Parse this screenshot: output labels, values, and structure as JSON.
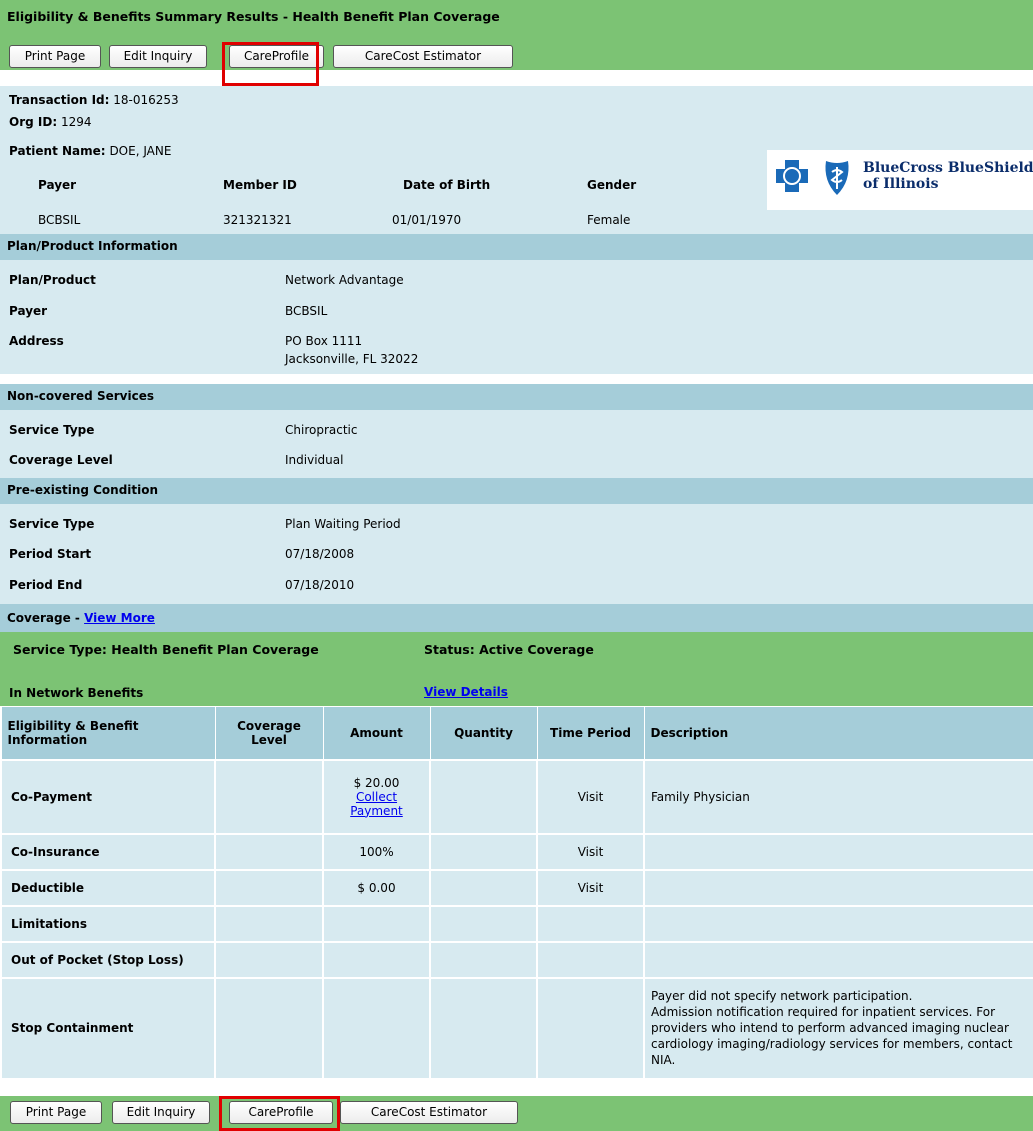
{
  "title": "Eligibility & Benefits Summary Results - Health Benefit Plan Coverage",
  "toolbar": {
    "print": "Print Page",
    "edit": "Edit Inquiry",
    "careprofile": "CareProfile",
    "carecost": "CareCost Estimator"
  },
  "transaction": {
    "txn_label": "Transaction Id:",
    "txn_value": "18-016253",
    "org_label": "Org ID:",
    "org_value": "1294",
    "patient_label": "Patient Name:",
    "patient_value": "DOE, JANE",
    "headers": [
      "Payer",
      "Member ID",
      "Date of Birth",
      "Gender"
    ],
    "values": [
      "BCBSIL",
      "321321321",
      "01/01/1970",
      "Female"
    ]
  },
  "logo": {
    "line1": "BlueCross BlueShield",
    "line2": "of Illinois"
  },
  "plan": {
    "header": "Plan/Product Information",
    "rows": [
      {
        "k": "Plan/Product",
        "v": "Network Advantage"
      },
      {
        "k": "Payer",
        "v": "BCBSIL"
      },
      {
        "k": "Address",
        "v": "PO Box 1111",
        "v2": "Jacksonville, FL 32022"
      }
    ]
  },
  "noncovered": {
    "header": "Non-covered Services",
    "rows": [
      {
        "k": "Service Type",
        "v": "Chiropractic"
      },
      {
        "k": "Coverage Level",
        "v": "Individual"
      }
    ]
  },
  "preexisting": {
    "header": "Pre-existing Condition",
    "rows": [
      {
        "k": "Service Type",
        "v": "Plan Waiting Period"
      },
      {
        "k": "Period Start",
        "v": "07/18/2008"
      },
      {
        "k": "Period End",
        "v": "07/18/2010"
      }
    ]
  },
  "coverage": {
    "label": "Coverage - ",
    "view_more": "View More",
    "service_type": "Service Type: Health Benefit Plan Coverage",
    "status": "Status: Active Coverage",
    "in_network": "In Network Benefits",
    "view_details": "View Details"
  },
  "benefits": {
    "columns": [
      "Eligibility & Benefit Information",
      "Coverage Level",
      "Amount",
      "Quantity",
      "Time Period",
      "Description"
    ],
    "rows": [
      {
        "info": "Co-Payment",
        "level": "",
        "amount": "$ 20.00",
        "amount_link1": "Collect",
        "amount_link2": "Payment",
        "quantity": "",
        "period": "Visit",
        "desc": "Family Physician"
      },
      {
        "info": "Co-Insurance",
        "level": "",
        "amount": "100%",
        "quantity": "",
        "period": "Visit",
        "desc": ""
      },
      {
        "info": "Deductible",
        "level": "",
        "amount": "$ 0.00",
        "quantity": "",
        "period": "Visit",
        "desc": ""
      },
      {
        "info": "Limitations",
        "level": "",
        "amount": "",
        "quantity": "",
        "period": "",
        "desc": ""
      },
      {
        "info": "Out of Pocket (Stop Loss)",
        "level": "",
        "amount": "",
        "quantity": "",
        "period": "",
        "desc": ""
      },
      {
        "info": "Stop Containment",
        "level": "",
        "amount": "",
        "quantity": "",
        "period": "",
        "desc1": "Payer did not specify network participation.",
        "desc2": "Admission notification required for inpatient services. For providers who intend to perform advanced imaging nuclear cardiology imaging/radiology services for members, contact NIA."
      }
    ]
  },
  "colors": {
    "green": "#7cc374",
    "light_blue": "#d7eaf0",
    "header_blue": "#a5cdd9",
    "highlight_red": "#e00000",
    "link_blue": "#0000ee"
  }
}
